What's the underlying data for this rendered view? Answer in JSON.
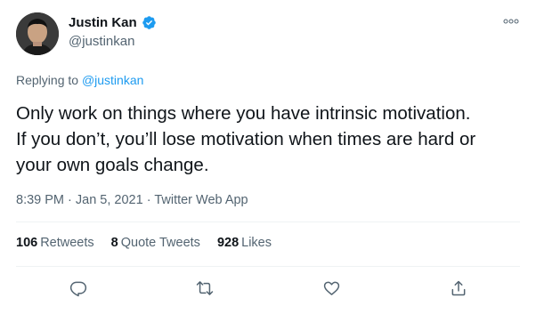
{
  "author": {
    "display_name": "Justin Kan",
    "handle": "@justinkan",
    "verified": true
  },
  "reply": {
    "prefix": "Replying to",
    "target": "@justinkan"
  },
  "tweet": {
    "text": "Only work on things where you have intrinsic motivation.\nIf you don’t, you’ll lose motivation when times are hard or\nyour own goals change."
  },
  "meta": {
    "time": "8:39 PM",
    "date": "Jan 5, 2021",
    "source": "Twitter Web App",
    "separator": " · "
  },
  "stats": {
    "retweets_count": "106",
    "retweets_label": "Retweets",
    "quotes_count": "8",
    "quotes_label": "Quote Tweets",
    "likes_count": "928",
    "likes_label": "Likes"
  },
  "colors": {
    "accent": "#1d9bf0",
    "verified": "#1d9bf0",
    "muted": "#536471",
    "icon": "#536471"
  },
  "icons": {
    "more": "more-icon",
    "verified": "verified-badge-icon",
    "reply": "reply-icon",
    "retweet": "retweet-icon",
    "like": "like-icon",
    "share": "share-icon"
  }
}
